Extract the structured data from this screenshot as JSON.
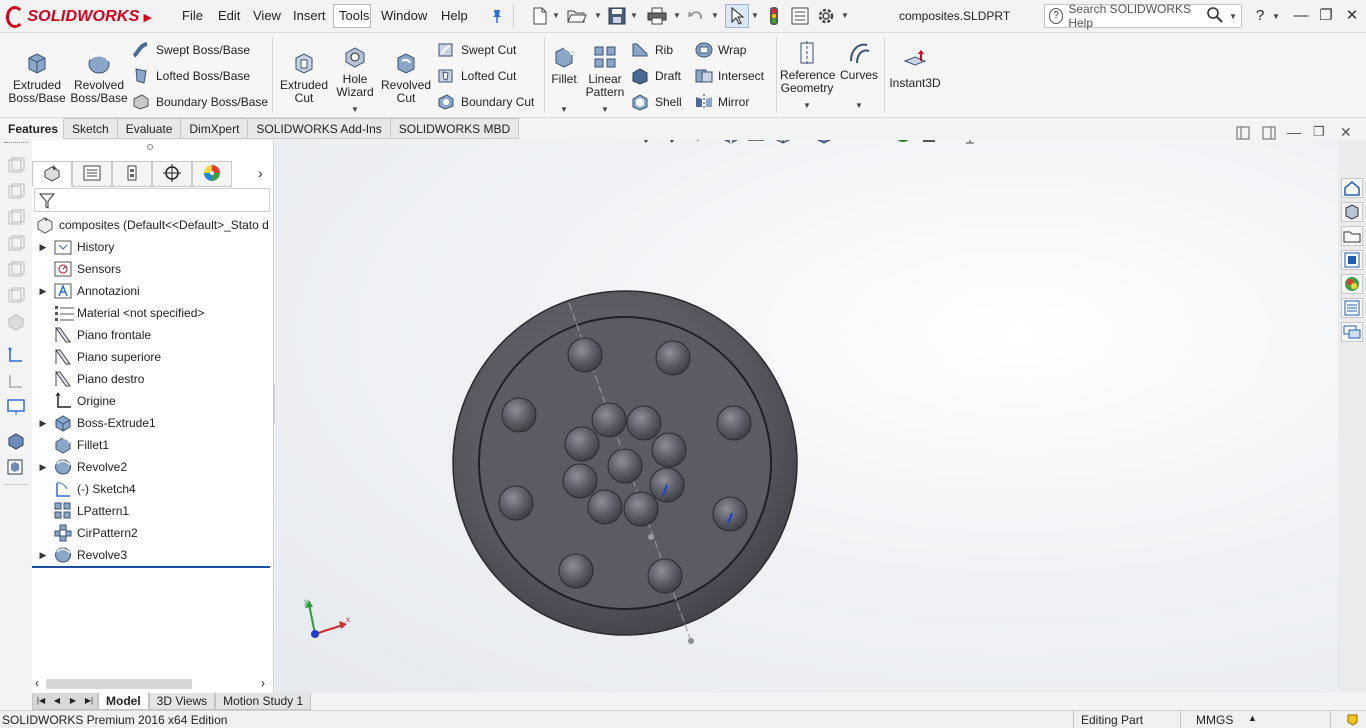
{
  "app": {
    "brand": "SOLIDWORKS",
    "document_title": "composites.SLDPRT",
    "accent_color": "#d6001c"
  },
  "menu": [
    "File",
    "Edit",
    "View",
    "Insert",
    "Tools",
    "Window",
    "Help"
  ],
  "search": {
    "placeholder": "Search SOLIDWORKS Help"
  },
  "help_glyph": "?",
  "commands": {
    "extruded_boss": "Extruded Boss/Base",
    "revolved_boss": "Revolved Boss/Base",
    "swept_boss": "Swept Boss/Base",
    "lofted_boss": "Lofted Boss/Base",
    "boundary_boss": "Boundary Boss/Base",
    "extruded_cut": "Extruded Cut",
    "hole_wizard": "Hole Wizard",
    "revolved_cut": "Revolved Cut",
    "swept_cut": "Swept Cut",
    "lofted_cut": "Lofted Cut",
    "boundary_cut": "Boundary Cut",
    "fillet": "Fillet",
    "linear_pattern": "Linear Pattern",
    "rib": "Rib",
    "draft": "Draft",
    "shell": "Shell",
    "wrap": "Wrap",
    "intersect": "Intersect",
    "mirror": "Mirror",
    "reference_geometry": "Reference Geometry",
    "curves": "Curves",
    "instant3d": "Instant3D"
  },
  "command_tabs": [
    "Features",
    "Sketch",
    "Evaluate",
    "DimXpert",
    "SOLIDWORKS Add-Ins",
    "SOLIDWORKS MBD"
  ],
  "tree": {
    "root": "composites  (Default<<Default>_Stato d",
    "items": [
      {
        "label": "History",
        "icon": "history-folder-icon",
        "expandable": true
      },
      {
        "label": "Sensors",
        "icon": "sensors-icon",
        "expandable": false
      },
      {
        "label": "Annotazioni",
        "icon": "annotations-icon",
        "expandable": true
      },
      {
        "label": "Material <not specified>",
        "icon": "material-icon",
        "expandable": false
      },
      {
        "label": "Piano frontale",
        "icon": "plane-icon",
        "expandable": false
      },
      {
        "label": "Piano superiore",
        "icon": "plane-icon",
        "expandable": false
      },
      {
        "label": "Piano destro",
        "icon": "plane-icon",
        "expandable": false
      },
      {
        "label": "Origine",
        "icon": "origin-icon",
        "expandable": false
      },
      {
        "label": "Boss-Extrude1",
        "icon": "extrude-icon",
        "expandable": true
      },
      {
        "label": "Fillet1",
        "icon": "fillet-icon",
        "expandable": false
      },
      {
        "label": "Revolve2",
        "icon": "revolve-icon",
        "expandable": true
      },
      {
        "label": "(-) Sketch4",
        "icon": "sketch-icon",
        "expandable": false
      },
      {
        "label": "LPattern1",
        "icon": "linear-pattern-icon",
        "expandable": false
      },
      {
        "label": "CirPattern2",
        "icon": "circular-pattern-icon",
        "expandable": false
      },
      {
        "label": "Revolve3",
        "icon": "revolve-icon",
        "expandable": true
      }
    ]
  },
  "triad": {
    "x_label": "x",
    "y_label": "y"
  },
  "bottom_tabs": [
    "Model",
    "3D Views",
    "Motion Study 1"
  ],
  "status": {
    "edition": "SOLIDWORKS Premium 2016 x64 Edition",
    "mode": "Editing Part",
    "units": "MMGS",
    "units_arrow": "▲"
  }
}
